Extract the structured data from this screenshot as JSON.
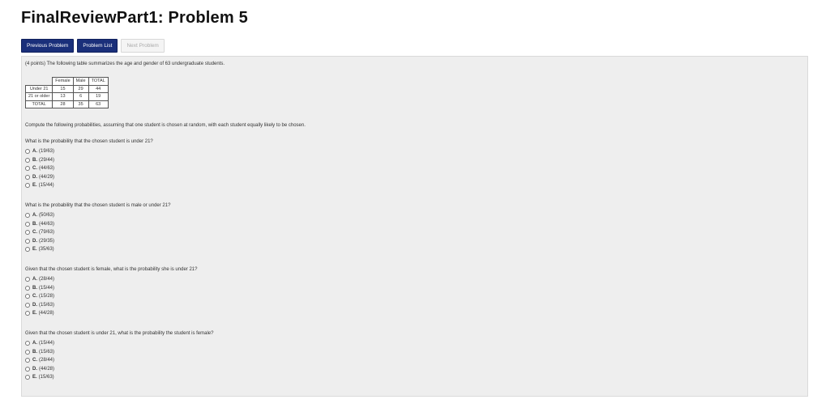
{
  "title": "FinalReviewPart1: Problem 5",
  "nav": {
    "previous": "Previous Problem",
    "list": "Problem List",
    "next": "Next Problem"
  },
  "problem": {
    "intro": "(4 points) The following table summarizes the age and gender of 63 undergraduate students.",
    "table": {
      "header": [
        "",
        "Female",
        "Male",
        "TOTAL"
      ],
      "rows": [
        [
          "Under 21",
          "15",
          "29",
          "44"
        ],
        [
          "21 or older",
          "13",
          "6",
          "19"
        ],
        [
          "TOTAL",
          "28",
          "35",
          "63"
        ]
      ]
    },
    "compute": "Compute the following probabilities, assuming that one student is chosen at random, with each student equally likely to be chosen.",
    "questions": [
      {
        "text": "What is the probability that the chosen student is under 21?",
        "options": [
          {
            "letter": "A.",
            "value": "(19/63)"
          },
          {
            "letter": "B.",
            "value": "(29/44)"
          },
          {
            "letter": "C.",
            "value": "(44/63)"
          },
          {
            "letter": "D.",
            "value": "(44/29)"
          },
          {
            "letter": "E.",
            "value": "(15/44)"
          }
        ]
      },
      {
        "text": "What is the probability that the chosen student is male or under 21?",
        "options": [
          {
            "letter": "A.",
            "value": "(50/63)"
          },
          {
            "letter": "B.",
            "value": "(44/63)"
          },
          {
            "letter": "C.",
            "value": "(79/63)"
          },
          {
            "letter": "D.",
            "value": "(29/35)"
          },
          {
            "letter": "E.",
            "value": "(35/63)"
          }
        ]
      },
      {
        "text": "Given that the chosen student is female, what is the probability she is under 21?",
        "options": [
          {
            "letter": "A.",
            "value": "(28/44)"
          },
          {
            "letter": "B.",
            "value": "(15/44)"
          },
          {
            "letter": "C.",
            "value": "(15/28)"
          },
          {
            "letter": "D.",
            "value": "(15/63)"
          },
          {
            "letter": "E.",
            "value": "(44/28)"
          }
        ]
      },
      {
        "text": "Given that the chosen student is under 21, what is the probability the student is female?",
        "options": [
          {
            "letter": "A.",
            "value": "(15/44)"
          },
          {
            "letter": "B.",
            "value": "(15/63)"
          },
          {
            "letter": "C.",
            "value": "(28/44)"
          },
          {
            "letter": "D.",
            "value": "(44/28)"
          },
          {
            "letter": "E.",
            "value": "(15/63)"
          }
        ]
      }
    ]
  }
}
